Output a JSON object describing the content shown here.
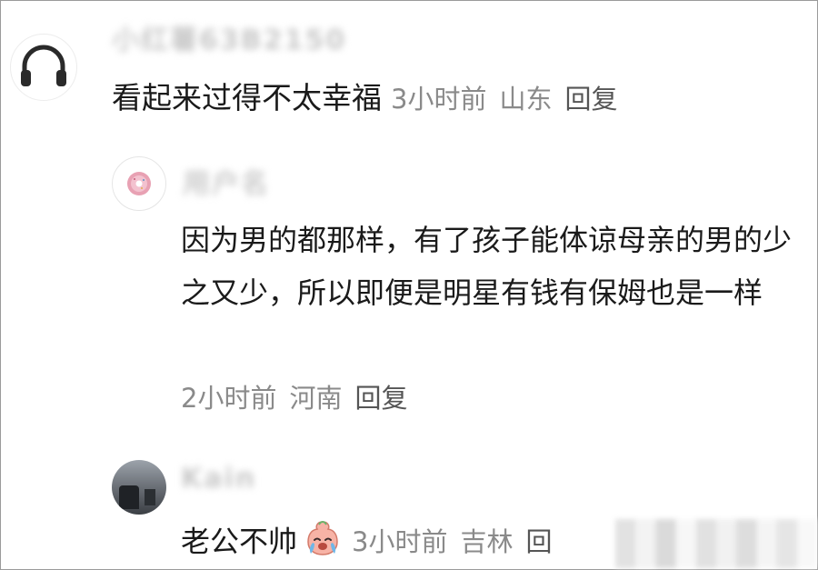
{
  "comments": [
    {
      "text": "看起来过得不太幸福",
      "time": "3小时前",
      "location": "山东",
      "reply": "回复"
    },
    {
      "text": "因为男的都那样，有了孩子能体谅母亲的男的少之又少，所以即便是明星有钱有保姆也是一样",
      "time": "2小时前",
      "location": "河南",
      "reply": "回复"
    },
    {
      "text": "老公不帅",
      "time": "3小时前",
      "location": "吉林",
      "reply": "回"
    }
  ],
  "icons": {
    "avatar_1": "headphones-icon",
    "avatar_2": "donut-icon",
    "emoji": "crying-laughing-emoji-icon"
  }
}
